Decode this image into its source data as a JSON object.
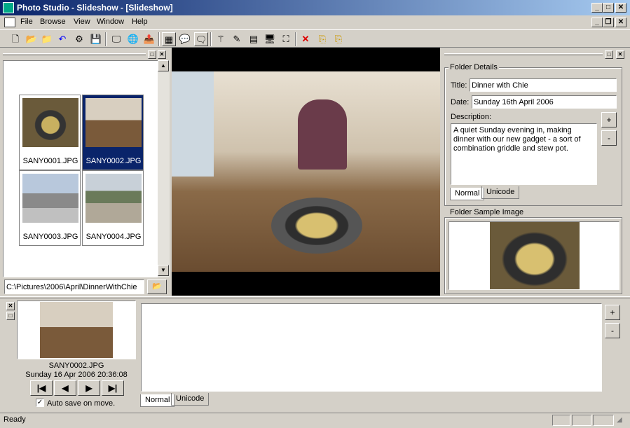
{
  "window": {
    "title": "Photo Studio - Slideshow - [Slideshow]"
  },
  "menu": [
    {
      "label": "File"
    },
    {
      "label": "Browse"
    },
    {
      "label": "View"
    },
    {
      "label": "Window"
    },
    {
      "label": "Help"
    }
  ],
  "thumbnails": [
    {
      "name": "SANY0001.JPG",
      "selected": false
    },
    {
      "name": "SANY0002.JPG",
      "selected": true
    },
    {
      "name": "SANY0003.JPG",
      "selected": false
    },
    {
      "name": "SANY0004.JPG",
      "selected": false
    }
  ],
  "path": {
    "value": "C:\\Pictures\\2006\\April\\DinnerWithChie"
  },
  "folder_details": {
    "group_label": "Folder Details",
    "title_label": "Title:",
    "title_value": "Dinner with Chie",
    "date_label": "Date:",
    "date_value": "Sunday 16th April 2006",
    "description_label": "Description:",
    "description_value": "A quiet Sunday evening in, making dinner with our new gadget - a sort of combination griddle and stew pot.",
    "plus": "+",
    "minus": "-",
    "tab_normal": "Normal",
    "tab_unicode": "Unicode"
  },
  "folder_sample": {
    "group_label": "Folder Sample Image"
  },
  "bottom": {
    "filename": "SANY0002.JPG",
    "timestamp": "Sunday 16 Apr 2006 20:36:08",
    "autosave_label": "Auto save on move.",
    "autosave_checked": true,
    "plus": "+",
    "minus": "-",
    "tab_normal": "Normal",
    "tab_unicode": "Unicode"
  },
  "status": {
    "text": "Ready"
  }
}
